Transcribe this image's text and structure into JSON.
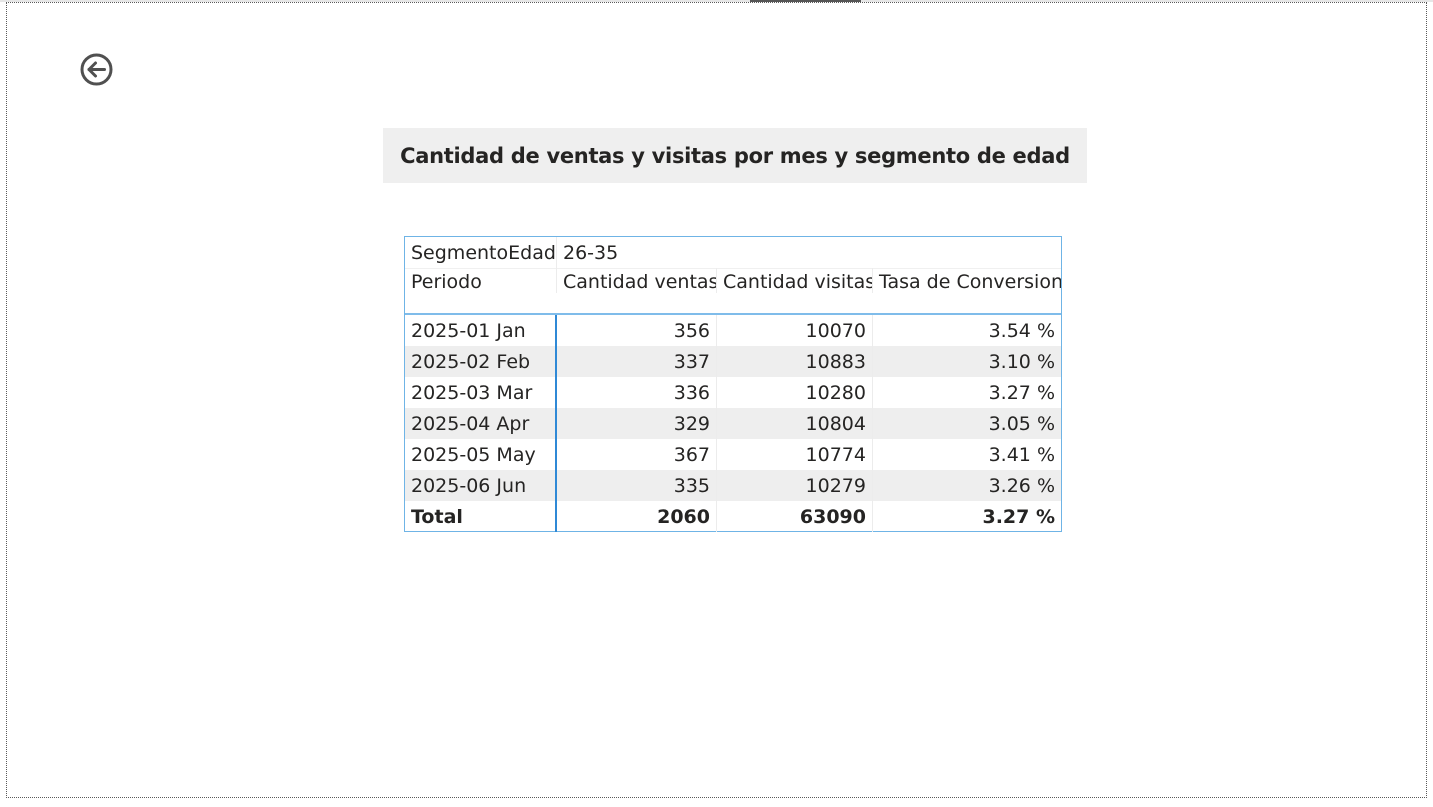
{
  "report": {
    "title": "Cantidad de ventas y visitas por mes y segmento de edad",
    "back_icon": "back-arrow-circle-icon"
  },
  "matrix": {
    "segment_label": "SegmentoEdad",
    "segment_value": "26-35",
    "columns": [
      "Periodo",
      "Cantidad ventas",
      "Cantidad visitas",
      "Tasa de Conversion"
    ],
    "rows": [
      {
        "periodo": "2025-01 Jan",
        "ventas": "356",
        "visitas": "10070",
        "tasa": "3.54 %"
      },
      {
        "periodo": "2025-02 Feb",
        "ventas": "337",
        "visitas": "10883",
        "tasa": "3.10 %"
      },
      {
        "periodo": "2025-03 Mar",
        "ventas": "336",
        "visitas": "10280",
        "tasa": "3.27 %"
      },
      {
        "periodo": "2025-04 Apr",
        "ventas": "329",
        "visitas": "10804",
        "tasa": "3.05 %"
      },
      {
        "periodo": "2025-05 May",
        "ventas": "367",
        "visitas": "10774",
        "tasa": "3.41 %"
      },
      {
        "periodo": "2025-06 Jun",
        "ventas": "335",
        "visitas": "10279",
        "tasa": "3.26 %"
      }
    ],
    "total": {
      "periodo": "Total",
      "ventas": "2060",
      "visitas": "63090",
      "tasa": "3.27 %"
    }
  }
}
